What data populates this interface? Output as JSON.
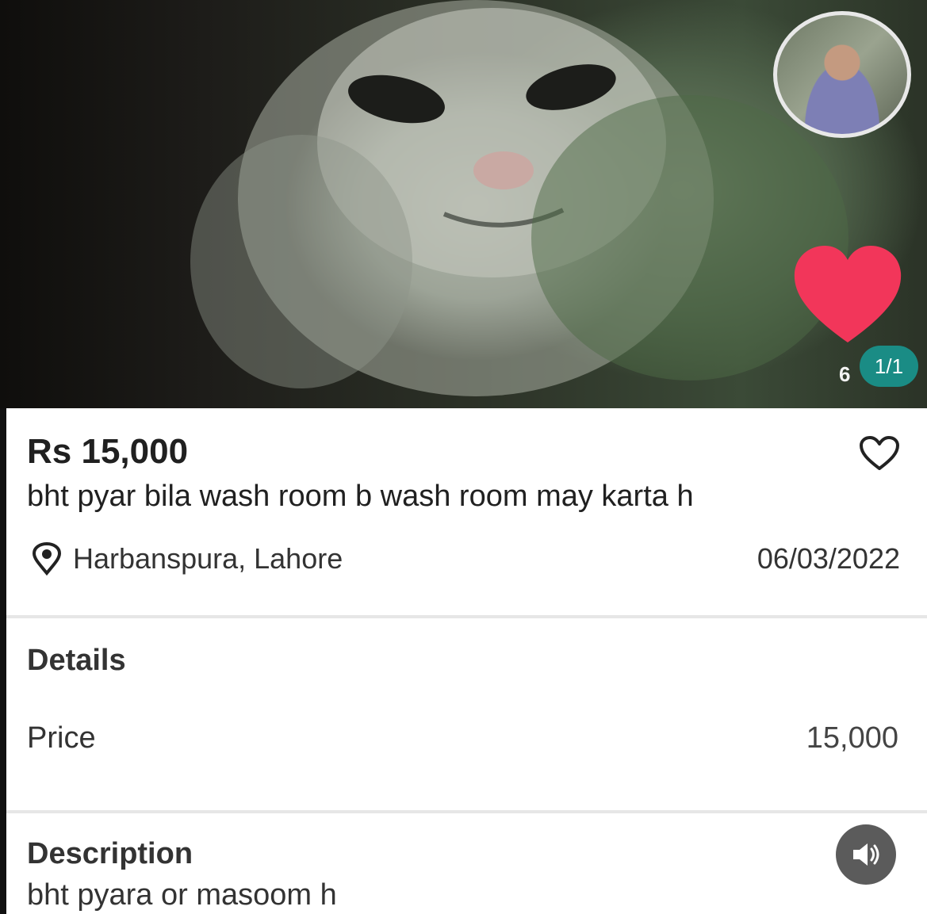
{
  "listing": {
    "price": "Rs 15,000",
    "title": "bht pyar bila wash room b wash room may karta h",
    "location": "Harbanspura, Lahore",
    "date": "06/03/2022"
  },
  "photo": {
    "like_count": "6",
    "image_counter": "1/1"
  },
  "details": {
    "heading": "Details",
    "price_label": "Price",
    "price_value": "15,000"
  },
  "description": {
    "heading": "Description",
    "text": "bht pyara or masoom h"
  },
  "icons": {
    "location": "location-pin-icon",
    "favorite": "heart-outline-icon",
    "like": "heart-filled-icon",
    "sound": "speaker-icon"
  },
  "colors": {
    "badge": "#1a8c85",
    "like_heart": "#f2365a",
    "sound_button": "#5b5b5b"
  }
}
